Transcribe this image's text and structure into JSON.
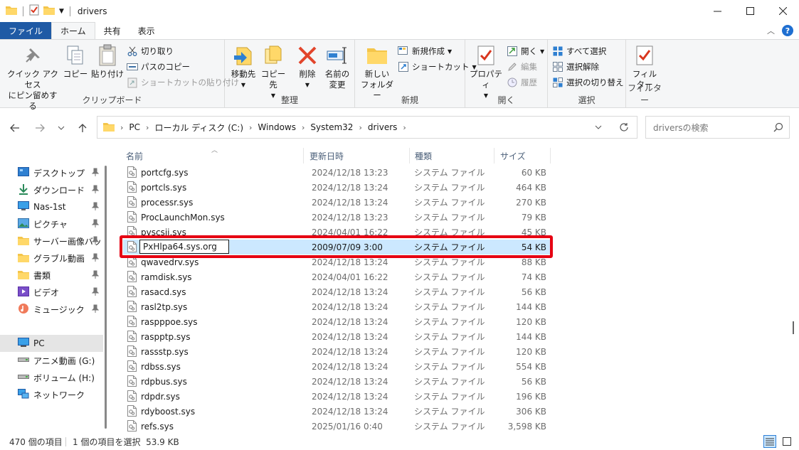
{
  "window": {
    "title": "drivers",
    "controls": [
      "minimize",
      "maximize",
      "close"
    ]
  },
  "tabs": [
    "ファイル",
    "ホーム",
    "共有",
    "表示"
  ],
  "ribbon": {
    "clipboard": {
      "label": "クリップボード",
      "pin_line1": "クイック アクセス",
      "pin_line2": "にピン留めする",
      "copy": "コピー",
      "paste": "貼り付け",
      "cut": "切り取り",
      "copy_path": "パスのコピー",
      "paste_shortcut": "ショートカットの貼り付け"
    },
    "organize": {
      "label": "整理",
      "move_to": "移動先",
      "copy_to": "コピー先",
      "delete": "削除",
      "rename_line1": "名前の",
      "rename_line2": "変更"
    },
    "new": {
      "label": "新規",
      "new_folder_line1": "新しい",
      "new_folder_line2": "フォルダー",
      "new_item": "新規作成",
      "shortcut": "ショートカット"
    },
    "open": {
      "label": "開く",
      "properties": "プロパティ",
      "open": "開く",
      "edit": "編集",
      "history": "履歴"
    },
    "select": {
      "label": "選択",
      "select_all": "すべて選択",
      "select_none": "選択解除",
      "invert": "選択の切り替え"
    },
    "filter": {
      "label": "フィルター",
      "btn_line1": "フィル",
      "btn_line2": "ター"
    }
  },
  "address": {
    "crumbs": [
      "PC",
      "ローカル ディスク (C:)",
      "Windows",
      "System32",
      "drivers"
    ]
  },
  "search": {
    "placeholder": "driversの検索"
  },
  "nav": {
    "items": [
      {
        "label": "デスクトップ",
        "icon": "desktop-icon",
        "pinned": true
      },
      {
        "label": "ダウンロード",
        "icon": "download-icon",
        "pinned": true
      },
      {
        "label": "Nas-1st",
        "icon": "monitor-icon",
        "pinned": true
      },
      {
        "label": "ピクチャ",
        "icon": "pictures-icon",
        "pinned": true
      },
      {
        "label": "サーバー画像バッ",
        "icon": "folder-icon",
        "pinned": true
      },
      {
        "label": "グラブル動画",
        "icon": "folder-icon",
        "pinned": true
      },
      {
        "label": "書類",
        "icon": "folder-icon",
        "pinned": true
      },
      {
        "label": "ビデオ",
        "icon": "video-icon",
        "pinned": true
      },
      {
        "label": "ミュージック",
        "icon": "music-icon",
        "pinned": true
      },
      {
        "label": "PC",
        "icon": "pc-icon",
        "pinned": false
      },
      {
        "label": "アニメ動画 (G:)",
        "icon": "drive-icon",
        "pinned": false
      },
      {
        "label": "ボリューム (H:)",
        "icon": "drive-icon",
        "pinned": false
      },
      {
        "label": "ネットワーク",
        "icon": "network-icon",
        "pinned": false
      }
    ]
  },
  "columns": {
    "name": "名前",
    "date": "更新日時",
    "type": "種類",
    "size": "サイズ"
  },
  "files": [
    {
      "name": "portcfg.sys",
      "date": "2024/12/18 13:23",
      "type": "システム ファイル",
      "size": "60 KB"
    },
    {
      "name": "portcls.sys",
      "date": "2024/12/18 13:24",
      "type": "システム ファイル",
      "size": "464 KB"
    },
    {
      "name": "processr.sys",
      "date": "2024/12/18 13:24",
      "type": "システム ファイル",
      "size": "270 KB"
    },
    {
      "name": "ProcLaunchMon.sys",
      "date": "2024/12/18 13:23",
      "type": "システム ファイル",
      "size": "79 KB"
    },
    {
      "name": "pvscsii.sys",
      "date": "2024/04/01 16:22",
      "type": "システム ファイル",
      "size": "45 KB"
    },
    {
      "name": "PxHlpa64.sys.org",
      "date": "2009/07/09 3:00",
      "type": "システム ファイル",
      "size": "54 KB"
    },
    {
      "name": "qwavedrv.sys",
      "date": "2024/12/18 13:24",
      "type": "システム ファイル",
      "size": "88 KB"
    },
    {
      "name": "ramdisk.sys",
      "date": "2024/04/01 16:22",
      "type": "システム ファイル",
      "size": "74 KB"
    },
    {
      "name": "rasacd.sys",
      "date": "2024/12/18 13:24",
      "type": "システム ファイル",
      "size": "56 KB"
    },
    {
      "name": "rasl2tp.sys",
      "date": "2024/12/18 13:24",
      "type": "システム ファイル",
      "size": "144 KB"
    },
    {
      "name": "raspppoe.sys",
      "date": "2024/12/18 13:24",
      "type": "システム ファイル",
      "size": "120 KB"
    },
    {
      "name": "raspptp.sys",
      "date": "2024/12/18 13:24",
      "type": "システム ファイル",
      "size": "144 KB"
    },
    {
      "name": "rassstp.sys",
      "date": "2024/12/18 13:24",
      "type": "システム ファイル",
      "size": "120 KB"
    },
    {
      "name": "rdbss.sys",
      "date": "2024/12/18 13:24",
      "type": "システム ファイル",
      "size": "554 KB"
    },
    {
      "name": "rdpbus.sys",
      "date": "2024/12/18 13:24",
      "type": "システム ファイル",
      "size": "56 KB"
    },
    {
      "name": "rdpdr.sys",
      "date": "2024/12/18 13:24",
      "type": "システム ファイル",
      "size": "196 KB"
    },
    {
      "name": "rdyboost.sys",
      "date": "2024/12/18 13:24",
      "type": "システム ファイル",
      "size": "306 KB"
    },
    {
      "name": "refs.sys",
      "date": "2025/01/16 0:40",
      "type": "システム ファイル",
      "size": "3,598 KB"
    }
  ],
  "selected_file": "PxHlpa64.sys.org",
  "status": {
    "count": "470 個の項目",
    "selection": "1 個の項目を選択  53.9 KB"
  },
  "colors": {
    "accent": "#1f5aa5",
    "selection": "#cce8ff",
    "highlight_box": "#e60012"
  }
}
